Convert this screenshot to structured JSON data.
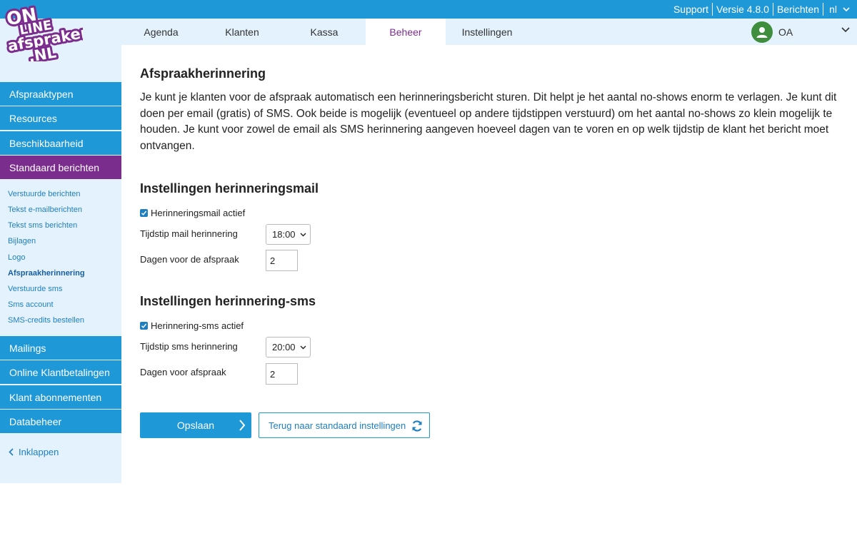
{
  "brand": {
    "logo_text": "ONLINE afspraken .NL"
  },
  "topbar": {
    "support": "Support",
    "version": "Versie 4.8.0",
    "messages": "Berichten",
    "language": "nl"
  },
  "nav": {
    "tabs": [
      {
        "label": "Agenda"
      },
      {
        "label": "Klanten"
      },
      {
        "label": "Kassa"
      },
      {
        "label": "Beheer"
      },
      {
        "label": "Instellingen"
      }
    ],
    "active": "Beheer",
    "user_initials": "OA"
  },
  "sidebar": {
    "items_top": [
      {
        "label": "Afspraaktypen"
      },
      {
        "label": "Resources"
      },
      {
        "label": "Beschikbaarheid"
      },
      {
        "label": "Standaard berichten"
      }
    ],
    "sublinks": [
      {
        "label": "Verstuurde berichten"
      },
      {
        "label": "Tekst e-mailberichten"
      },
      {
        "label": "Tekst sms berichten"
      },
      {
        "label": "Bijlagen"
      },
      {
        "label": "Logo"
      },
      {
        "label": "Afspraakherinnering"
      },
      {
        "label": "Verstuurde sms"
      },
      {
        "label": "Sms account"
      },
      {
        "label": "SMS-credits bestellen"
      }
    ],
    "items_bottom": [
      {
        "label": "Mailings"
      },
      {
        "label": "Online Klantbetalingen"
      },
      {
        "label": "Klant abonnementen"
      },
      {
        "label": "Databeheer"
      }
    ],
    "collapse_label": "Inklappen"
  },
  "main": {
    "title": "Afspraakherinnering",
    "intro": "Je kunt je klanten voor de afspraak automatisch een herinneringsbericht sturen. Dit helpt je het aantal no-shows enorm te verlagen. Je kunt dit doen per email (gratis) of SMS. Ook beide is mogelijk (eventueel op andere tijdstippen verstuurd) om het aantal no-shows zo klein mogelijk te houden. Je kunt voor zowel de email als SMS herinnering aangeven hoeveel dagen van te voren en op welk tijdstip de klant het bericht moet ontvangen.",
    "mail": {
      "heading": "Instellingen herinneringsmail",
      "active_label": "Herinneringsmail actief",
      "active": true,
      "time_label": "Tijdstip mail herinnering",
      "time_value": "18:00",
      "days_label": "Dagen voor de afspraak",
      "days_value": "2"
    },
    "sms": {
      "heading": "Instellingen herinnering-sms",
      "active_label": "Herinnering-sms actief",
      "active": true,
      "time_label": "Tijdstip sms herinnering",
      "time_value": "20:00",
      "days_label": "Dagen voor afspraak",
      "days_value": "2"
    },
    "save_label": "Opslaan",
    "reset_label": "Terug naar standaard instellingen"
  },
  "colors": {
    "accent_blue": "#1e98d7",
    "accent_purple": "#7b2d8e",
    "nav_bg": "#e3f2fc",
    "avatar_green": "#3e8e3e"
  }
}
